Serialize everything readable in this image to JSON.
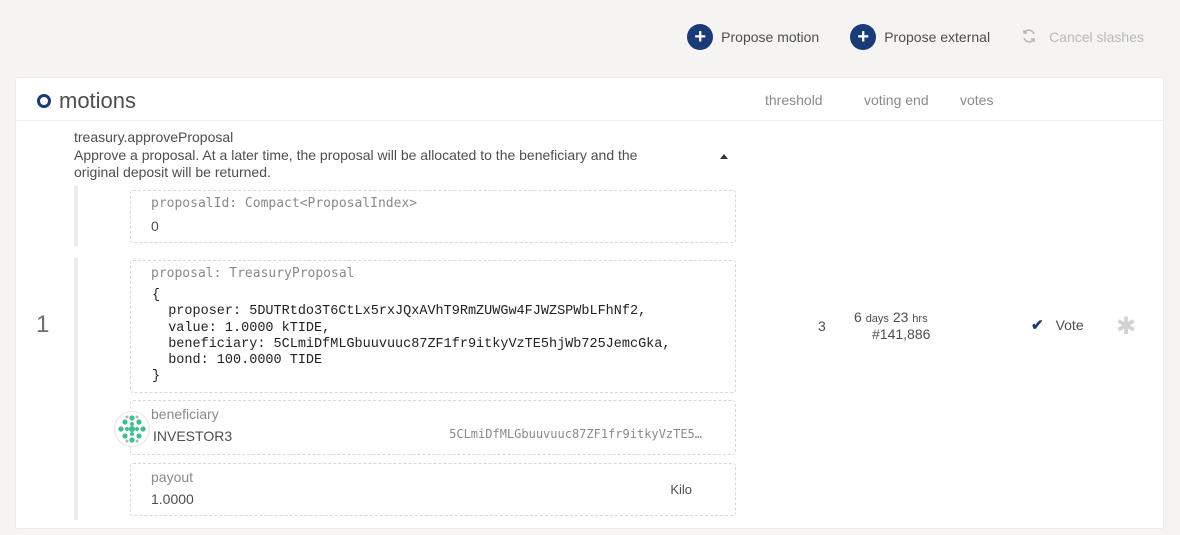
{
  "toolbar": {
    "propose_motion": "Propose motion",
    "propose_external": "Propose external",
    "cancel_slashes": "Cancel slashes"
  },
  "section": {
    "title": "motions",
    "columns": {
      "threshold": "threshold",
      "voting_end": "voting end",
      "votes": "votes"
    }
  },
  "motion": {
    "index": "1",
    "method": "treasury.approveProposal",
    "description": "Approve a proposal. At a later time, the proposal will be allocated to the beneficiary and the original deposit will be returned.",
    "params": [
      {
        "label": "proposalId: Compact<ProposalIndex>",
        "value": "0"
      }
    ],
    "proposal": {
      "label": "proposal: TreasuryProposal",
      "code": "{\n  proposer: 5DUTRtdo3T6CtLx5rxJQxAVhT9RmZUWGw4FJWZSPWbLFhNf2,\n  value: 1.0000 kTIDE,\n  beneficiary: 5CLmiDfMLGbuuvuuc87ZF1fr9itkyVzTE5hjWb725JemcGka,\n  bond: 100.0000 TIDE\n}"
    },
    "beneficiary": {
      "label": "beneficiary",
      "name": "INVESTOR3",
      "address": "5CLmiDfMLGbuuvuuc87ZF1fr9itkyVzTE5…"
    },
    "payout": {
      "label": "payout",
      "value": "1.0000",
      "unit": "Kilo"
    },
    "threshold": "3",
    "voting_end": {
      "days": "6",
      "days_label": "days",
      "hrs": "23",
      "hrs_label": "hrs",
      "block": "#141,886"
    },
    "vote_label": "Vote"
  },
  "colors": {
    "accent": "#1b3a78",
    "identicon": "#3fbf8c"
  },
  "icons": [
    "plus-icon",
    "sync-icon",
    "check-icon",
    "star-icon",
    "identicon"
  ]
}
